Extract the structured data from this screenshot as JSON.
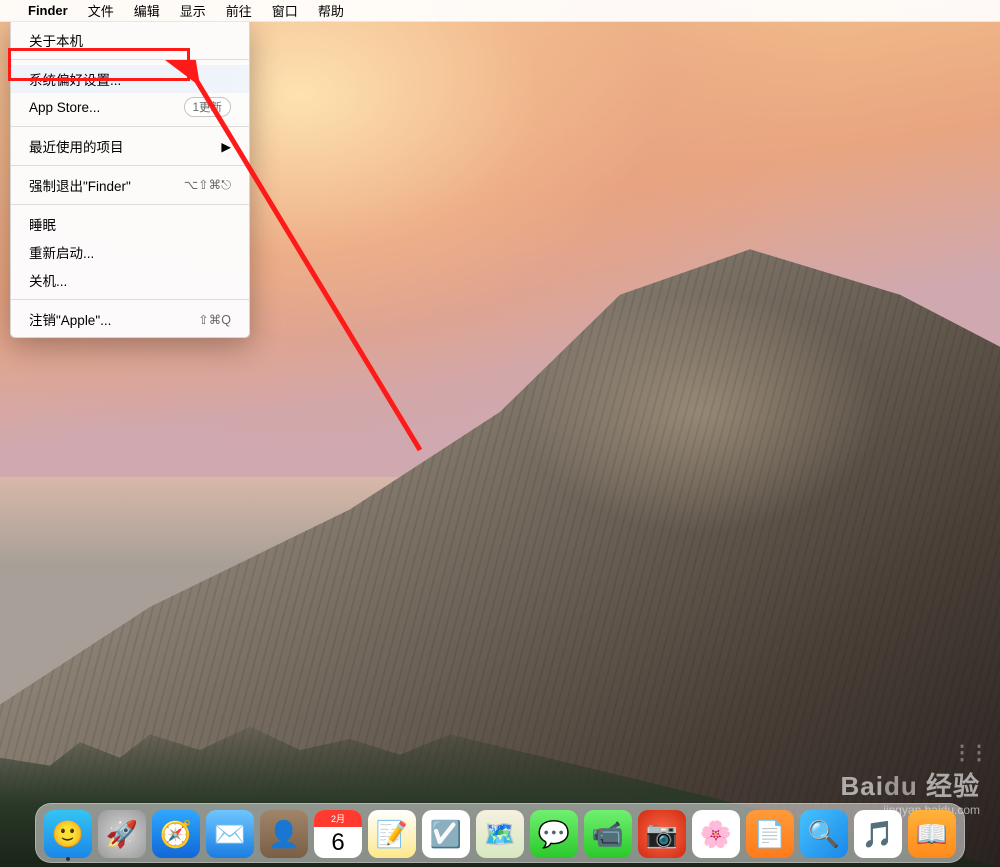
{
  "menubar": {
    "items": [
      {
        "label": "Finder",
        "bold": true
      },
      {
        "label": "文件"
      },
      {
        "label": "编辑"
      },
      {
        "label": "显示"
      },
      {
        "label": "前往"
      },
      {
        "label": "窗口"
      },
      {
        "label": "帮助"
      }
    ]
  },
  "apple_menu": {
    "about": "关于本机",
    "preferences": "系统偏好设置...",
    "app_store_label": "App Store...",
    "app_store_badge": "1更新",
    "recent_items": "最近使用的项目",
    "force_quit_label": "强制退出\"Finder\"",
    "force_quit_shortcut": "⌥⇧⌘⎋",
    "sleep": "睡眠",
    "restart": "重新启动...",
    "shutdown": "关机...",
    "logout_label": "注销\"Apple\"...",
    "logout_shortcut": "⇧⌘Q",
    "submenu_marker": "▶"
  },
  "dock": {
    "items": [
      {
        "name": "finder",
        "bg": "linear-gradient(180deg,#34c4f3,#1a87e8)",
        "glyph": "🙂",
        "running": true
      },
      {
        "name": "launchpad",
        "bg": "radial-gradient(circle,#d8d8d8,#999)",
        "glyph": "🚀"
      },
      {
        "name": "safari",
        "bg": "linear-gradient(180deg,#2ea7ff,#1167d6)",
        "glyph": "🧭"
      },
      {
        "name": "mail",
        "bg": "linear-gradient(180deg,#6ec6ff,#1a7de0)",
        "glyph": "✉️"
      },
      {
        "name": "contacts",
        "bg": "linear-gradient(180deg,#a0856a,#7a5f44)",
        "glyph": "👤"
      },
      {
        "name": "calendar",
        "bg": "#ffffff",
        "glyph": "📅",
        "text_top": "2月",
        "text_main": "6"
      },
      {
        "name": "notes",
        "bg": "linear-gradient(180deg,#fff,#ffe88a)",
        "glyph": "📝"
      },
      {
        "name": "reminders",
        "bg": "#fff",
        "glyph": "☑️"
      },
      {
        "name": "maps",
        "bg": "linear-gradient(180deg,#f5f0e0,#d8e8c0)",
        "glyph": "🗺️"
      },
      {
        "name": "messages",
        "bg": "linear-gradient(180deg,#70f070,#2ac92a)",
        "glyph": "💬"
      },
      {
        "name": "facetime",
        "bg": "linear-gradient(180deg,#70f070,#2ac92a)",
        "glyph": "📹"
      },
      {
        "name": "photo-booth",
        "bg": "radial-gradient(circle,#ff6a4a,#d02a10)",
        "glyph": "📷"
      },
      {
        "name": "photos",
        "bg": "#fff",
        "glyph": "🌸"
      },
      {
        "name": "pages",
        "bg": "linear-gradient(180deg,#ff9a3a,#ff7a1a)",
        "glyph": "📄"
      },
      {
        "name": "preview",
        "bg": "linear-gradient(135deg,#45c2ff,#1a87e8)",
        "glyph": "🔍"
      },
      {
        "name": "itunes",
        "bg": "#fff",
        "glyph": "🎵"
      },
      {
        "name": "ibooks",
        "bg": "linear-gradient(180deg,#ffb23a,#ff8a1a)",
        "glyph": "📖"
      }
    ]
  },
  "calendar": {
    "month": "2月",
    "day": "6"
  },
  "watermark": {
    "brand_prefix": "Bai",
    "brand_mid": "du",
    "brand_suffix": "经验",
    "url": "jingyan.baidu.com"
  }
}
